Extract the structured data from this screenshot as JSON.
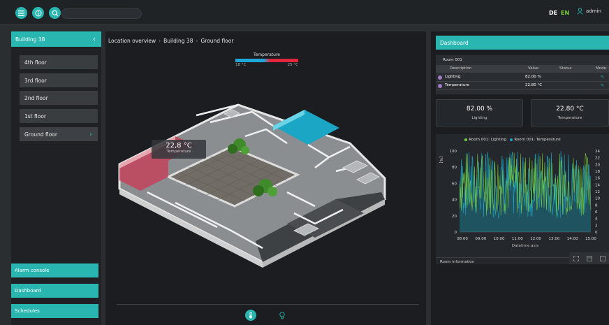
{
  "topbar": {
    "search": {
      "value": "",
      "placeholder": ""
    },
    "lang_de": "DE",
    "lang_en": "EN",
    "user": "admin",
    "icons": [
      "menu-icon",
      "info-icon",
      "search-icon",
      "user-icon"
    ]
  },
  "left": {
    "header": "Building 38",
    "floors": [
      "4th floor",
      "3rd floor",
      "2nd floor",
      "1st floor",
      "Ground floor"
    ],
    "bottom": [
      "Alarm console",
      "Dashboard",
      "Schedules"
    ]
  },
  "center": {
    "breadcrumb": [
      "Location overview",
      "Building 38",
      "Ground floor"
    ],
    "legend": {
      "title": "Temperature",
      "min": "18 °C",
      "max": "25 °C"
    },
    "tooltip": {
      "value": "22,8 °C",
      "label": "Temperature"
    }
  },
  "right": {
    "header": "Dashboard",
    "room_title": "Room 001",
    "columns": [
      "Description",
      "Value",
      "Status",
      "Mode"
    ],
    "rows": [
      {
        "description": "Lighting",
        "value": "82.00 %"
      },
      {
        "description": "Temperature",
        "value": "22.80 °C"
      }
    ],
    "kpis": [
      {
        "value": "82.00 %",
        "label": "Lighting"
      },
      {
        "value": "22.80 °C",
        "label": "Temperature"
      }
    ],
    "room_info": "Room information"
  },
  "colors": {
    "accent": "#29b6b1",
    "lighting": "#7ccf3a",
    "temperature": "#1aa6c4",
    "hot": "#e2263e"
  },
  "chart_data": {
    "type": "area",
    "title": "",
    "series": [
      {
        "name": "Room 001: Lighting",
        "color": "#7ccf3a"
      },
      {
        "name": "Room 001: Temperature",
        "color": "#1aa6c4"
      }
    ],
    "ylabel_left": "[%]",
    "yticks_left": [
      0,
      20,
      40,
      60,
      80,
      100
    ],
    "yticks_right": [
      0,
      2,
      4,
      6,
      8,
      10,
      12,
      14,
      16,
      18,
      20,
      22,
      24
    ],
    "xticks": [
      "08:00",
      "09:00",
      "10:00",
      "11:00",
      "12:00",
      "13:00",
      "14:00",
      "15:00"
    ],
    "xlabel": "Datetime axis",
    "ylim_left": [
      0,
      100
    ],
    "ylim_right": [
      0,
      24
    ]
  }
}
